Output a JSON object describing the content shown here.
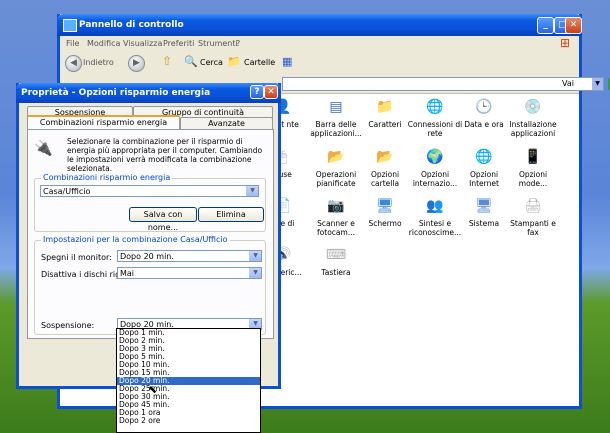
{
  "control_panel": {
    "title": "Pannello di controllo",
    "menu": [
      "File",
      "Modifica",
      "Visualizza",
      "Preferiti",
      "Strumenti",
      "?"
    ],
    "toolbar": {
      "back": "Indietro",
      "search": "Cerca",
      "folders": "Cartelle"
    },
    "go": "Vai",
    "icons": [
      {
        "label": "ount nte",
        "glyph": "👤",
        "color": "#6a8cc8"
      },
      {
        "label": "Barra delle applicazioni...",
        "glyph": "▤",
        "color": "#3a6ac8"
      },
      {
        "label": "Caratteri",
        "glyph": "📁",
        "color": "#f0c040"
      },
      {
        "label": "Connessioni di rete",
        "glyph": "🌐",
        "color": "#3a8ad8"
      },
      {
        "label": "Data e ora",
        "glyph": "🕒",
        "color": "#9ab0d8"
      },
      {
        "label": "Installazione applicazioni",
        "glyph": "💿",
        "color": "#c8a0d8"
      },
      {
        "label": "ouse",
        "glyph": "🖱",
        "color": "#b0b0b0"
      },
      {
        "label": "Operazioni pianificate",
        "glyph": "📂",
        "color": "#e8c040"
      },
      {
        "label": "Opzioni cartella",
        "glyph": "📂",
        "color": "#f0c840"
      },
      {
        "label": "Opzioni internazio...",
        "glyph": "🌍",
        "color": "#3a8ad8"
      },
      {
        "label": "Opzioni Internet",
        "glyph": "🌐",
        "color": "#3a8ad8"
      },
      {
        "label": "Opzioni mode...",
        "glyph": "📱",
        "color": "#6a6a8a"
      },
      {
        "label": "che di ",
        "glyph": "📄",
        "color": "#c0c0c0"
      },
      {
        "label": "Scanner e fotocam...",
        "glyph": "📷",
        "color": "#8a9ab8"
      },
      {
        "label": "Schermo",
        "glyph": "🖥",
        "color": "#3a8ad8"
      },
      {
        "label": "Sintesi e riconoscime...",
        "glyph": "👥",
        "color": "#d88a3a"
      },
      {
        "label": "Sistema",
        "glyph": "🖥",
        "color": "#5a8ad8"
      },
      {
        "label": "Stampanti e fax",
        "glyph": "🖨",
        "color": "#b0b0b0"
      },
      {
        "label": "ni e eric...",
        "glyph": "🔊",
        "color": "#b0b0b0"
      },
      {
        "label": "Tastiera",
        "glyph": "⌨",
        "color": "#b0b0b0"
      }
    ]
  },
  "dialog": {
    "title": "Proprietà - Opzioni risparmio energia",
    "tabs_back": [
      "Sospensione",
      "Gruppo di continuità"
    ],
    "tabs_front": [
      "Combinazioni risparmio energia",
      "Avanzate"
    ],
    "description": "Selezionare la combinazione per il risparmio di energia più appropriata per il computer. Cambiando le impostazioni verrà modificata la combinazione selezionata.",
    "scheme_group": "Combinazioni risparmio energia",
    "scheme_value": "Casa/Ufficio",
    "save_as": "Salva con nome...",
    "delete": "Elimina",
    "settings_group": "Impostazioni per la combinazione Casa/Ufficio",
    "monitor_label": "Spegni il monitor:",
    "monitor_value": "Dopo 20 min.",
    "disks_label": "Disattiva i dischi rigidi:",
    "disks_value": "Mai",
    "standby_label": "Sospensione:",
    "standby_value": "Dopo 20 min.",
    "dropdown_options": [
      "Dopo 1 min.",
      "Dopo 2 min.",
      "Dopo 3 min.",
      "Dopo 5 min.",
      "Dopo 10 min.",
      "Dopo 15 min.",
      "Dopo 20 min.",
      "Dopo 25 min.",
      "Dopo 30 min.",
      "Dopo 45 min.",
      "Dopo 1 ora",
      "Dopo 2 ore"
    ],
    "dropdown_selected_index": 6
  }
}
